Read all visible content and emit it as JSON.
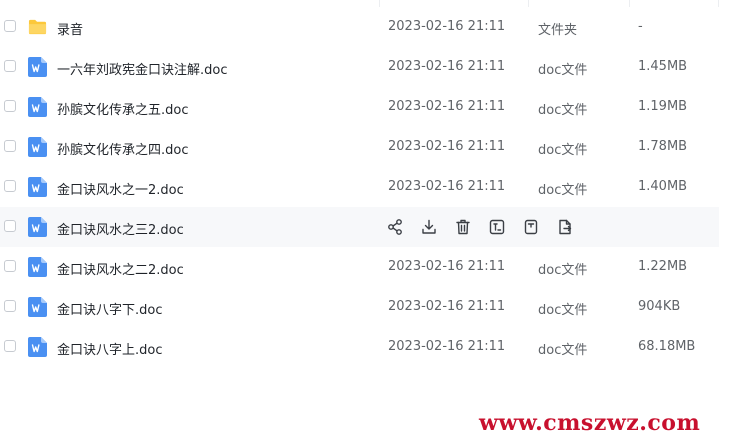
{
  "files": [
    {
      "name": "录音",
      "date": "2023-02-16 21:11",
      "type": "文件夹",
      "size": "-",
      "icon": "folder-icon"
    },
    {
      "name": "一六年刘政宪金口诀注解.doc",
      "date": "2023-02-16 21:11",
      "type": "doc文件",
      "size": "1.45MB",
      "icon": "word-doc-icon"
    },
    {
      "name": "孙膑文化传承之五.doc",
      "date": "2023-02-16 21:11",
      "type": "doc文件",
      "size": "1.19MB",
      "icon": "word-doc-icon"
    },
    {
      "name": "孙膑文化传承之四.doc",
      "date": "2023-02-16 21:11",
      "type": "doc文件",
      "size": "1.78MB",
      "icon": "word-doc-icon"
    },
    {
      "name": "金口诀风水之一2.doc",
      "date": "2023-02-16 21:11",
      "type": "doc文件",
      "size": "1.40MB",
      "icon": "word-doc-icon"
    },
    {
      "name": "金口诀风水之三2.doc",
      "date": "",
      "type": "",
      "size": "",
      "icon": "word-doc-icon",
      "hovered": true
    },
    {
      "name": "金口诀风水之二2.doc",
      "date": "2023-02-16 21:11",
      "type": "doc文件",
      "size": "1.22MB",
      "icon": "word-doc-icon"
    },
    {
      "name": "金口诀八字下.doc",
      "date": "2023-02-16 21:11",
      "type": "doc文件",
      "size": "904KB",
      "icon": "word-doc-icon"
    },
    {
      "name": "金口诀八字上.doc",
      "date": "2023-02-16 21:11",
      "type": "doc文件",
      "size": "68.18MB",
      "icon": "word-doc-icon"
    }
  ],
  "row_actions": [
    "share-icon",
    "download-icon",
    "delete-icon",
    "rename-icon",
    "move-icon",
    "copy-icon"
  ],
  "colors": {
    "folder": "#fcc83b",
    "word": "#4a90f2",
    "action": "#3b3f45",
    "watermark": "#c8102e",
    "hover_bg": "#f7f8fa"
  },
  "watermark": "www.cmszwz.com"
}
